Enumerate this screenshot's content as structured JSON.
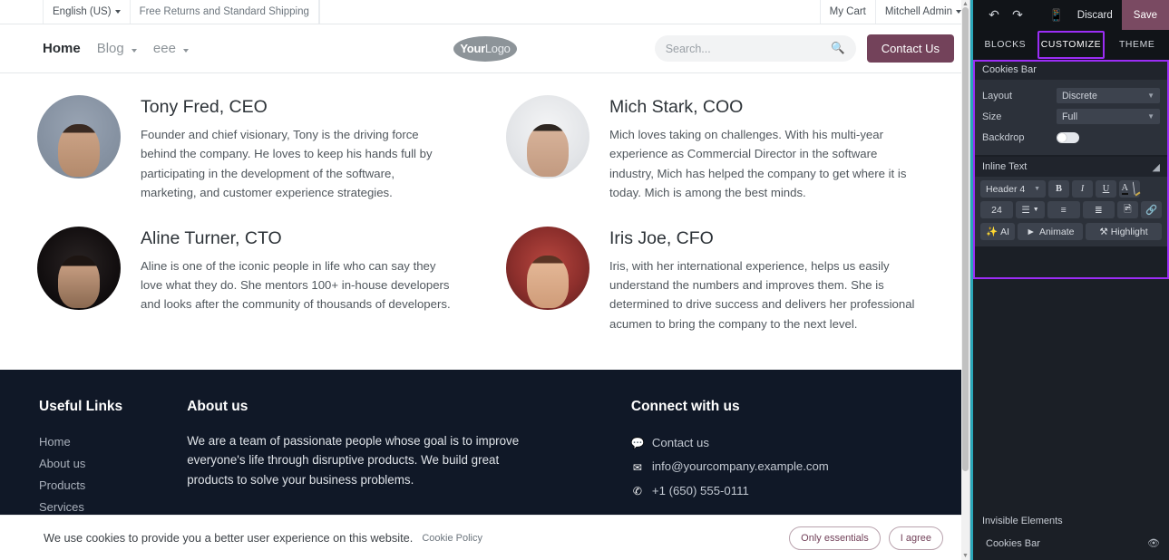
{
  "site": {
    "topbar": {
      "language": "English (US)",
      "promo": "Free Returns and Standard Shipping",
      "cart": "My Cart",
      "user": "Mitchell Admin"
    },
    "nav": {
      "items": [
        {
          "label": "Home",
          "has_caret": false
        },
        {
          "label": "Blog",
          "has_caret": true
        },
        {
          "label": "eee",
          "has_caret": true
        }
      ],
      "logo_bold": "Your",
      "logo_light": "Logo",
      "search_placeholder": "Search...",
      "contact_button": "Contact Us"
    },
    "team": [
      {
        "name": "Tony Fred, CEO",
        "desc": "Founder and chief visionary, Tony is the driving force behind the company. He loves to keep his hands full by participating in the development of the software, marketing, and customer experience strategies."
      },
      {
        "name": "Mich Stark, COO",
        "desc": "Mich loves taking on challenges. With his multi-year experience as Commercial Director in the software industry, Mich has helped the company to get where it is today. Mich is among the best minds."
      },
      {
        "name": "Aline Turner, CTO",
        "desc": "Aline is one of the iconic people in life who can say they love what they do. She mentors 100+ in-house developers and looks after the community of thousands of developers."
      },
      {
        "name": "Iris Joe, CFO",
        "desc": "Iris, with her international experience, helps us easily understand the numbers and improves them. She is determined to drive success and delivers her professional acumen to bring the company to the next level."
      }
    ],
    "footer": {
      "useful_links_title": "Useful Links",
      "useful_links": [
        "Home",
        "About us",
        "Products",
        "Services"
      ],
      "about_title": "About us",
      "about_text": "We are a team of passionate people whose goal is to improve everyone's life through disruptive products. We build great products to solve your business problems.",
      "connect_title": "Connect with us",
      "contacts": [
        {
          "icon": "chat-icon",
          "glyph": "💬",
          "label": "Contact us"
        },
        {
          "icon": "envelope-icon",
          "glyph": "✉",
          "label": "info@yourcompany.example.com"
        },
        {
          "icon": "phone-icon",
          "glyph": "✆",
          "label": "+1 (650) 555-0111"
        }
      ]
    },
    "cookies": {
      "message": "We use cookies to provide you a better user experience on this website.",
      "policy_link": "Cookie Policy",
      "only_essentials": "Only essentials",
      "i_agree": "I agree"
    }
  },
  "editor": {
    "toolbar": {
      "undo_icon": "undo-icon",
      "redo_icon": "redo-icon",
      "mobile_icon": "mobile-preview-icon",
      "discard": "Discard",
      "save": "Save"
    },
    "tabs": [
      {
        "label": "BLOCKS",
        "selected": false
      },
      {
        "label": "CUSTOMIZE",
        "selected": true
      },
      {
        "label": "THEME",
        "selected": false
      }
    ],
    "cookies_bar": {
      "title": "Cookies Bar",
      "layout_label": "Layout",
      "layout_value": "Discrete",
      "size_label": "Size",
      "size_value": "Full",
      "backdrop_label": "Backdrop",
      "backdrop_on": false
    },
    "inline_text": {
      "title": "Inline Text",
      "eraser_icon": "eraser-icon",
      "style_value": "Header 4",
      "bold": "B",
      "italic": "I",
      "underline": "U",
      "font_color": "A",
      "highlight_color_icon": "brush-icon",
      "font_size": "24",
      "align_icon": "align-left-icon",
      "unordered_list_icon": "bullet-list-icon",
      "ordered_list_icon": "numbered-list-icon",
      "image_icon": "image-icon",
      "link_icon": "link-icon",
      "ai_label": "AI",
      "animate_label": "Animate",
      "highlight_label": "Highlight"
    },
    "invisible_elements": {
      "title": "Invisible Elements",
      "items": [
        {
          "label": "Cookies Bar",
          "icon": "eye-icon"
        }
      ]
    },
    "colors": {
      "accent_purple": "#9b2df5",
      "accent_teal": "#2aa6b8",
      "save_button": "#7a4a62",
      "panel_bg": "#1b1f26",
      "section_bg": "#2c313a"
    }
  }
}
